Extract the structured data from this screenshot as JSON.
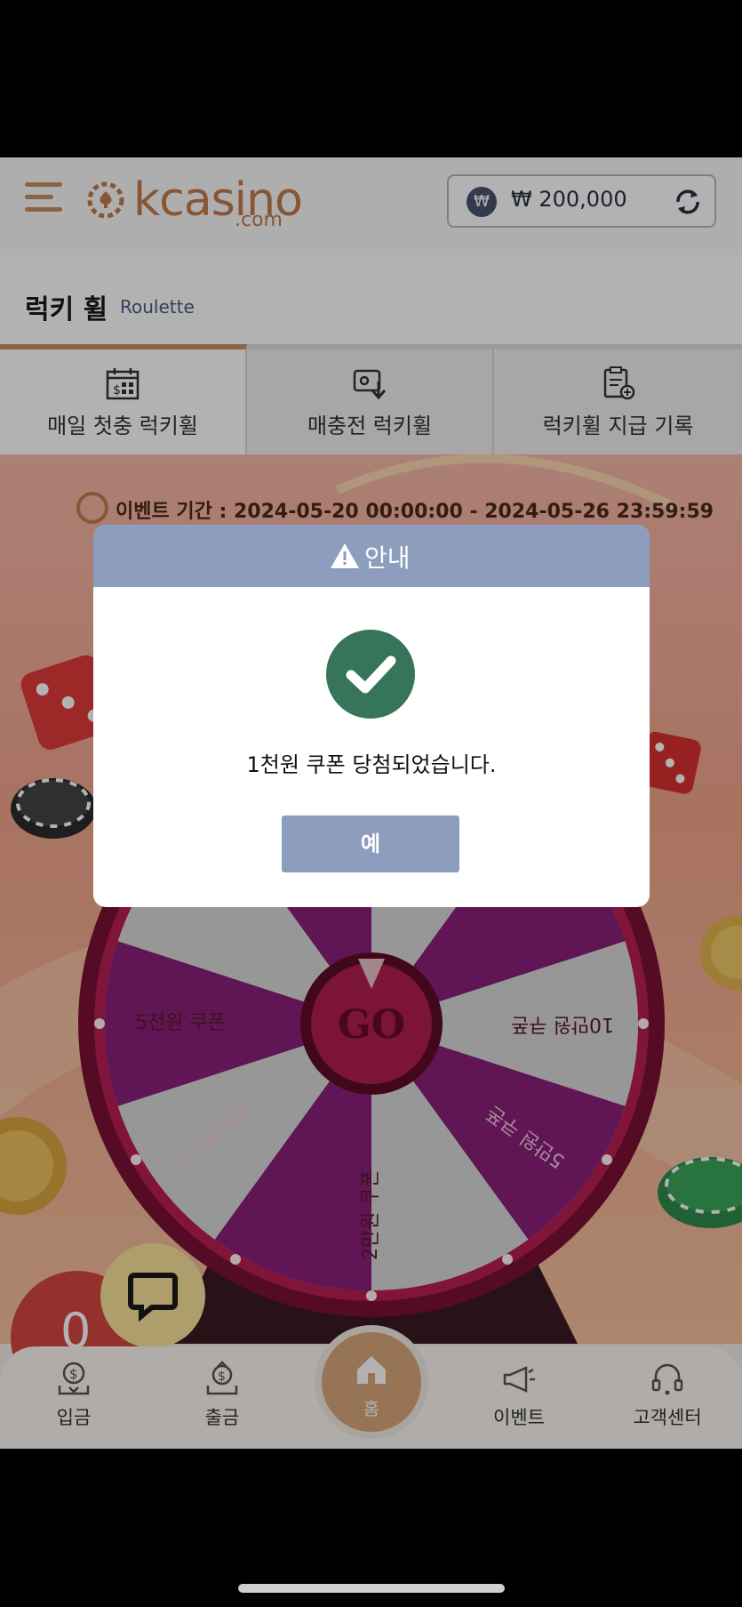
{
  "header": {
    "logo_text": "kcasino",
    "logo_sub": ".com",
    "balance": "₩ 200,000",
    "currency_symbol": "₩"
  },
  "page": {
    "title": "럭키 휠",
    "subtitle": "Roulette"
  },
  "tabs": [
    {
      "label": "매일 첫충 럭키휠",
      "active": true
    },
    {
      "label": "매충전 럭키휠",
      "active": false
    },
    {
      "label": "럭키휠 지급 기록",
      "active": false
    }
  ],
  "event": {
    "period": "이벤트 기간 : 2024-05-20 00:00:00 - 2024-05-26 23:59:59"
  },
  "wheel": {
    "center_label": "GO",
    "segments": [
      "5천원 쿠폰",
      "1만원 쿠폰",
      "2만원 쿠폰",
      "5만원 쿠폰",
      "10만원 쿠폰"
    ]
  },
  "badge": {
    "count": "0"
  },
  "bottom_nav": [
    {
      "label": "입금",
      "icon": "deposit-icon"
    },
    {
      "label": "출금",
      "icon": "withdraw-icon"
    },
    {
      "label": "홈",
      "icon": "home-icon"
    },
    {
      "label": "이벤트",
      "icon": "megaphone-icon"
    },
    {
      "label": "고객센터",
      "icon": "headset-icon"
    }
  ],
  "modal": {
    "title": "안내",
    "message": "1천원 쿠폰 당첨되었습니다.",
    "confirm_label": "예"
  },
  "colors": {
    "accent": "#c27c4e",
    "modal_header": "#8d9dbd",
    "success": "#36755a",
    "wheel_magenta": "#8a1f7a",
    "wheel_gray": "#d8d8d8"
  }
}
